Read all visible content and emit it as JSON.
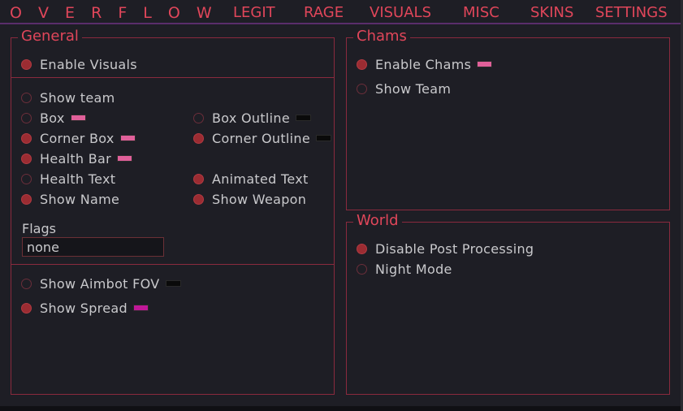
{
  "app": {
    "logo": "O V E R F L O W"
  },
  "tabs": [
    {
      "label": "LEGIT"
    },
    {
      "label": "RAGE"
    },
    {
      "label": "VISUALS"
    },
    {
      "label": "MISC"
    },
    {
      "label": "SKINS"
    },
    {
      "label": "SETTINGS"
    }
  ],
  "general": {
    "title": "General",
    "enable_visuals": {
      "label": "Enable Visuals",
      "checked": true
    },
    "show_team": {
      "label": "Show team",
      "checked": false
    },
    "box": {
      "label": "Box",
      "checked": false,
      "color": "#e0609a"
    },
    "box_outline": {
      "label": "Box Outline",
      "checked": false,
      "color": "#0a0a0a"
    },
    "corner_box": {
      "label": "Corner Box",
      "checked": true,
      "color": "#e0609a"
    },
    "corner_outline": {
      "label": "Corner Outline",
      "checked": true,
      "color": "#0a0a0a"
    },
    "health_bar": {
      "label": "Health Bar",
      "checked": true,
      "color": "#e0609a"
    },
    "health_text": {
      "label": "Health Text",
      "checked": false
    },
    "animated_text": {
      "label": "Animated Text",
      "checked": true
    },
    "show_name": {
      "label": "Show Name",
      "checked": true
    },
    "show_weapon": {
      "label": "Show Weapon",
      "checked": true
    },
    "flags_label": "Flags",
    "flags_value": "none",
    "show_aimbot_fov": {
      "label": "Show Aimbot FOV",
      "checked": false,
      "color": "#0a0a0a"
    },
    "show_spread": {
      "label": "Show Spread",
      "checked": true,
      "color": "#c01898"
    }
  },
  "chams": {
    "title": "Chams",
    "enable_chams": {
      "label": "Enable Chams",
      "checked": true,
      "color": "#e0609a"
    },
    "show_team": {
      "label": "Show Team",
      "checked": false
    }
  },
  "world": {
    "title": "World",
    "disable_post_processing": {
      "label": "Disable Post Processing",
      "checked": true
    },
    "night_mode": {
      "label": "Night Mode",
      "checked": false
    }
  }
}
